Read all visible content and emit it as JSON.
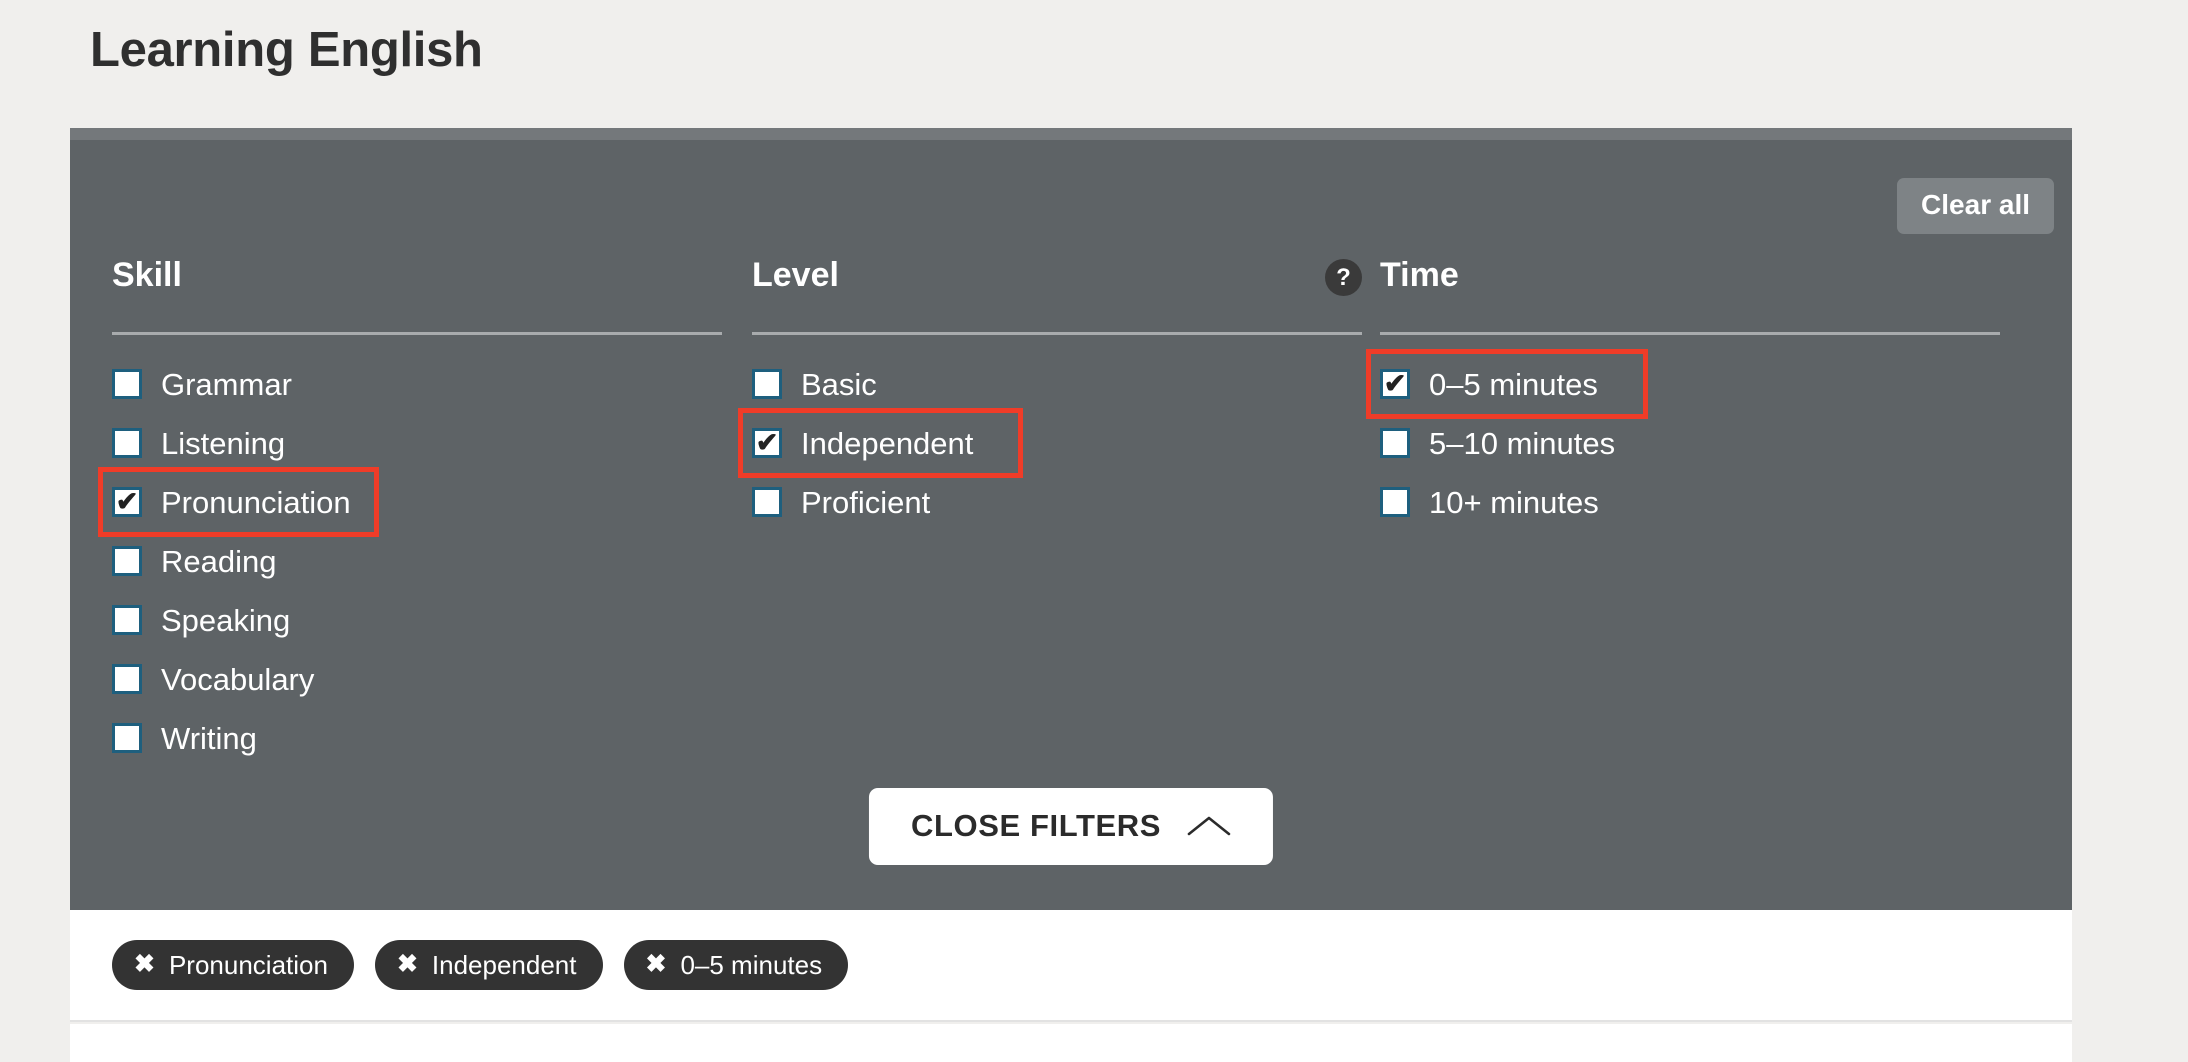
{
  "page": {
    "title": "Learning English",
    "background_color": "#f0efed"
  },
  "panel": {
    "background_color": "#5e6366",
    "clear_all_label": "Clear all",
    "close_filters_label": "CLOSE FILTERS",
    "close_filters_icon": "chevron-up-icon",
    "columns": [
      {
        "title": "Skill",
        "help_icon": null,
        "options": [
          {
            "label": "Grammar",
            "checked": false,
            "annotated": false
          },
          {
            "label": "Listening",
            "checked": false,
            "annotated": false
          },
          {
            "label": "Pronunciation",
            "checked": true,
            "annotated": true
          },
          {
            "label": "Reading",
            "checked": false,
            "annotated": false
          },
          {
            "label": "Speaking",
            "checked": false,
            "annotated": false
          },
          {
            "label": "Vocabulary",
            "checked": false,
            "annotated": false
          },
          {
            "label": "Writing",
            "checked": false,
            "annotated": false
          }
        ]
      },
      {
        "title": "Level",
        "help_icon": "?",
        "options": [
          {
            "label": "Basic",
            "checked": false,
            "annotated": false
          },
          {
            "label": "Independent",
            "checked": true,
            "annotated": true
          },
          {
            "label": "Proficient",
            "checked": false,
            "annotated": false
          }
        ]
      },
      {
        "title": "Time",
        "help_icon": null,
        "options": [
          {
            "label": "0–5 minutes",
            "checked": true,
            "annotated": true
          },
          {
            "label": "5–10 minutes",
            "checked": false,
            "annotated": false
          },
          {
            "label": "10+ minutes",
            "checked": false,
            "annotated": false
          }
        ]
      }
    ]
  },
  "chips": {
    "remove_icon": "✖",
    "items": [
      {
        "label": "Pronunciation"
      },
      {
        "label": "Independent"
      },
      {
        "label": "0–5 minutes"
      }
    ]
  },
  "colors": {
    "annotation_red": "#f03c28",
    "checkbox_border": "#1e5f7e",
    "panel_gray": "#5e6366",
    "chip_dark": "#333333"
  },
  "checkmark_glyph": "✔"
}
